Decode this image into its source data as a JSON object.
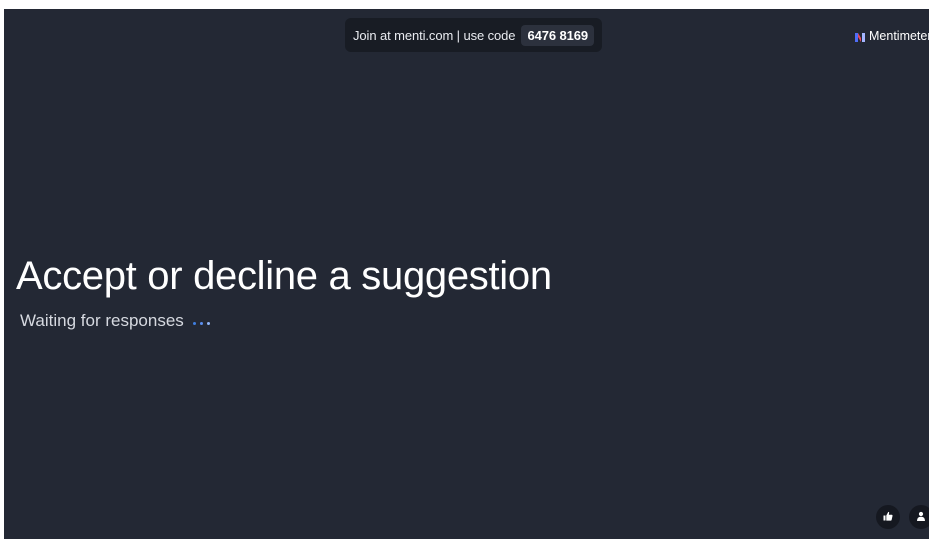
{
  "join": {
    "text": "Join at menti.com | use code",
    "code": "6476 8169"
  },
  "brand": {
    "name": "Mentimeter",
    "logo_icon": "mentimeter-logo-icon"
  },
  "slide": {
    "title": "Accept or decline a suggestion",
    "status": "Waiting for responses"
  },
  "controls": {
    "like_icon": "thumbs-up-icon",
    "audience_icon": "person-icon"
  },
  "colors": {
    "background": "#232834",
    "accent_blue": "#3f7fe0",
    "logo_red": "#e8475c",
    "logo_blue": "#4f6df5"
  }
}
